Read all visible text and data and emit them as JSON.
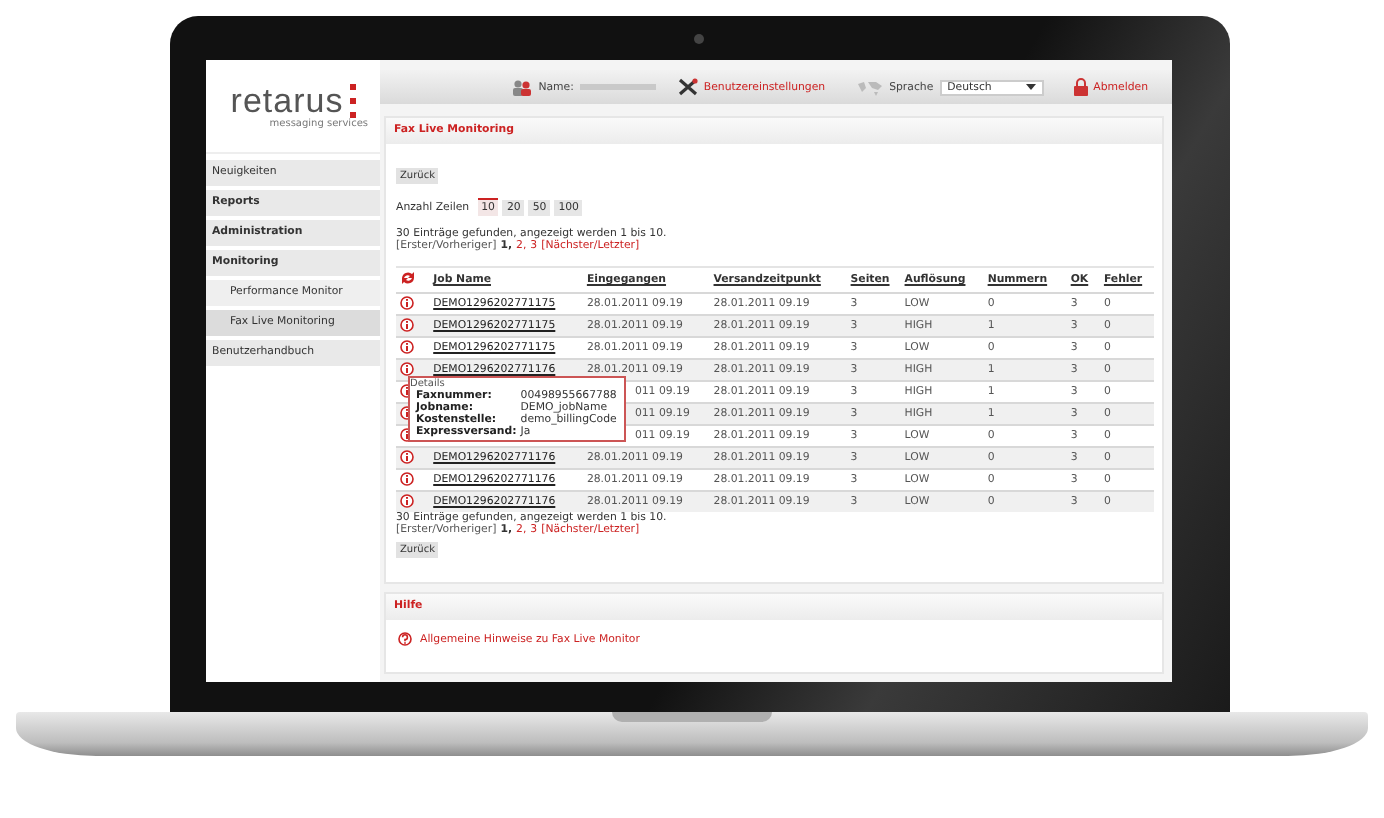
{
  "header": {
    "logo": "retarus",
    "logo_tagline": "messaging services",
    "name_label": "Name:",
    "settings_link": "Benutzereinstellungen",
    "language_label": "Sprache",
    "language": "Deutsch",
    "logout": "Abmelden"
  },
  "sidebar": {
    "items": [
      {
        "label": "Neuigkeiten",
        "kind": "item"
      },
      {
        "label": "Reports",
        "kind": "section"
      },
      {
        "label": "Administration",
        "kind": "section"
      },
      {
        "label": "Monitoring",
        "kind": "section",
        "children": [
          {
            "label": "Performance Monitor",
            "selected": false
          },
          {
            "label": "Fax Live Monitoring",
            "selected": true
          }
        ]
      },
      {
        "label": "Benutzerhandbuch",
        "kind": "item"
      }
    ]
  },
  "panel": {
    "title": "Fax Live Monitoring",
    "back_button": "Zurück",
    "rows_label": "Anzahl Zeilen",
    "page_sizes": [
      {
        "label": "10",
        "selected": true
      },
      {
        "label": "20",
        "selected": false
      },
      {
        "label": "50",
        "selected": false
      },
      {
        "label": "100",
        "selected": false
      }
    ],
    "summary_top": "30 Einträge gefunden, angezeigt werden 1 bis 10.",
    "pager_top": {
      "first_prev": "[Erster/Vorheriger]",
      "pages": [
        {
          "label": "1,",
          "selected": true
        },
        {
          "label": "2,",
          "selected": false
        },
        {
          "label": "3",
          "selected": false
        }
      ],
      "next_last": "[Nächster/Letzter]"
    },
    "table": {
      "columns": [
        "Job Name",
        "Eingegangen",
        "Versandzeitpunkt",
        "Seiten",
        "Auflösung",
        "Nummern",
        "OK",
        "Fehler"
      ],
      "rows": [
        {
          "job_name": "DEMO1296202771175",
          "received": "28.01.2011 09.19",
          "sent": "28.01.2011 09.19",
          "pages": "3",
          "resolution": "LOW",
          "numbers": "0",
          "ok": "3",
          "errors": "0"
        },
        {
          "job_name": "DEMO1296202771175",
          "received": "28.01.2011 09.19",
          "sent": "28.01.2011 09.19",
          "pages": "3",
          "resolution": "HIGH",
          "numbers": "1",
          "ok": "3",
          "errors": "0"
        },
        {
          "job_name": "DEMO1296202771175",
          "received": "28.01.2011 09.19",
          "sent": "28.01.2011 09.19",
          "pages": "3",
          "resolution": "LOW",
          "numbers": "0",
          "ok": "3",
          "errors": "0"
        },
        {
          "job_name": "DEMO1296202771176",
          "received": "28.01.2011 09.19",
          "sent": "28.01.2011 09.19",
          "pages": "3",
          "resolution": "HIGH",
          "numbers": "1",
          "ok": "3",
          "errors": "0"
        },
        {
          "received": "011 09.19",
          "sent": "28.01.2011 09.19",
          "pages": "3",
          "resolution": "HIGH",
          "numbers": "1",
          "ok": "3",
          "errors": "0"
        },
        {
          "received": "011 09.19",
          "sent": "28.01.2011 09.19",
          "pages": "3",
          "resolution": "HIGH",
          "numbers": "1",
          "ok": "3",
          "errors": "0"
        },
        {
          "received": "011 09.19",
          "sent": "28.01.2011 09.19",
          "pages": "3",
          "resolution": "LOW",
          "numbers": "0",
          "ok": "3",
          "errors": "0"
        },
        {
          "job_name": "DEMO1296202771176",
          "received": "28.01.2011 09.19",
          "sent": "28.01.2011 09.19",
          "pages": "3",
          "resolution": "LOW",
          "numbers": "0",
          "ok": "3",
          "errors": "0"
        },
        {
          "job_name": "DEMO1296202771176",
          "received": "28.01.2011 09.19",
          "sent": "28.01.2011 09.19",
          "pages": "3",
          "resolution": "LOW",
          "numbers": "0",
          "ok": "3",
          "errors": "0"
        },
        {
          "job_name": "DEMO1296202771176",
          "received": "28.01.2011 09.19",
          "sent": "28.01.2011 09.19",
          "pages": "3",
          "resolution": "LOW",
          "numbers": "0",
          "ok": "3",
          "errors": "0"
        }
      ]
    },
    "tooltip": {
      "title": "Details",
      "fields": [
        {
          "label": "Faxnummer:",
          "value": "00498955667788"
        },
        {
          "label": "Jobname:",
          "value": "DEMO_jobName"
        },
        {
          "label": "Kostenstelle:",
          "value": "demo_billingCode"
        },
        {
          "label": "Expressversand:",
          "value": "Ja"
        }
      ]
    },
    "summary_bottom": "30 Einträge gefunden, angezeigt werden 1 bis 10.",
    "pager_bottom": {
      "first_prev": "[Erster/Vorheriger]",
      "pages": [
        {
          "label": "1,",
          "selected": true
        },
        {
          "label": "2,",
          "selected": false
        },
        {
          "label": "3",
          "selected": false
        }
      ],
      "next_last": "[Nächster/Letzter]"
    },
    "back_button_bottom": "Zurück"
  },
  "help": {
    "title": "Hilfe",
    "link": "Allgemeine Hinweise zu Fax Live Monitor"
  }
}
